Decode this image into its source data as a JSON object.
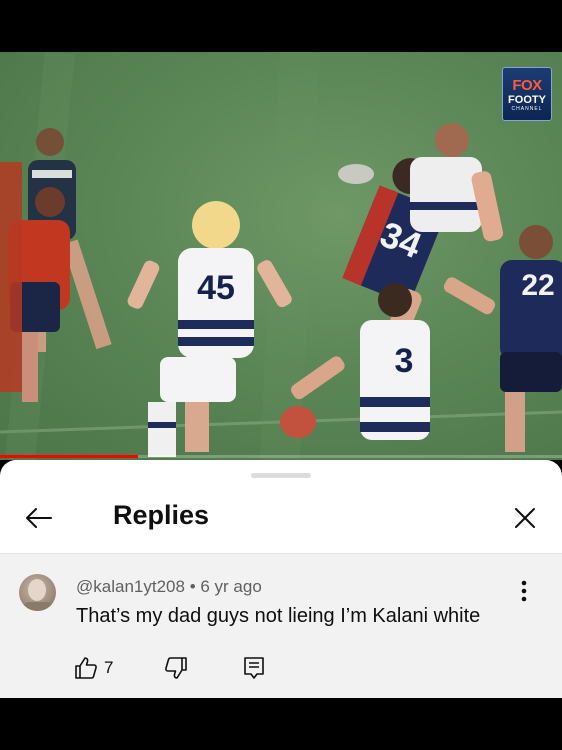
{
  "video": {
    "progress_fraction": 0.245,
    "logo": {
      "line1": "FOX",
      "line2": "FOOTY",
      "line3": "CHANNEL"
    },
    "jersey_numbers": [
      "45",
      "34",
      "3",
      "22"
    ]
  },
  "panel": {
    "title": "Replies",
    "back_icon": "arrow-left-icon",
    "close_icon": "close-icon"
  },
  "comment": {
    "author": "@kalan1yt208",
    "separator": "•",
    "age": "6 yr ago",
    "text": "That’s my dad guys not lieing I’m Kalani white",
    "like_count": "7",
    "icons": [
      "thumb-up-icon",
      "thumb-down-icon",
      "reply-icon",
      "more-vert-icon"
    ]
  },
  "colors": {
    "accent_progress": "#ff0000",
    "text_primary": "#0f0f0f",
    "text_secondary": "#606060",
    "comment_bg": "#f2f2f2"
  }
}
